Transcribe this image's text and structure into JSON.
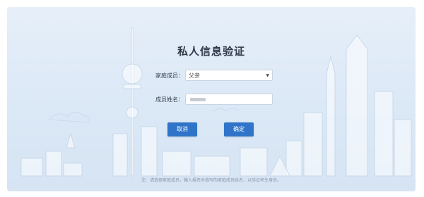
{
  "form": {
    "title": "私人信息验证",
    "family_member_label": "家庭成员：",
    "family_member_value": "父亲",
    "member_name_label": "成员姓名：",
    "member_name_value": "",
    "cancel_label": "取消",
    "confirm_label": "确定",
    "note": "注：请选择家庭成员，输入报名时填写的家庭成员姓名，以验证考生身份。"
  },
  "colors": {
    "button": "#2f74c9",
    "panel_bg": "#dbe8f6"
  },
  "icons": {
    "select_arrow": "chevron-down-icon"
  }
}
